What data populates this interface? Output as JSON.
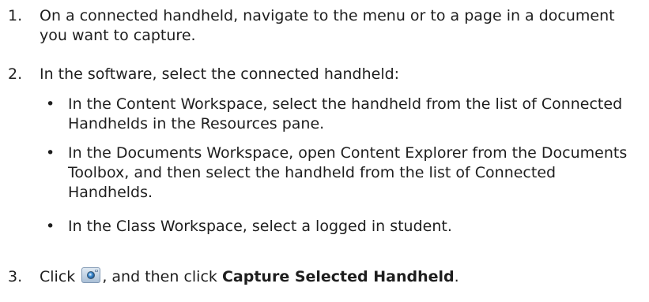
{
  "steps": [
    {
      "number": "1.",
      "text": "On a connected handheld, navigate to the menu or to a page in a document you want to capture."
    },
    {
      "number": "2.",
      "text": "In the software, select the connected handheld:",
      "bullets": [
        {
          "symbol": "•",
          "text": "In the Content Workspace, select the handheld from the list of Connected Handhelds in the Resources pane."
        },
        {
          "symbol": "•",
          "text": "In the Documents Workspace, open Content Explorer from the Documents Toolbox, and then select the handheld from the list of Connected Handhelds."
        },
        {
          "symbol": "•",
          "text": "In the Class Workspace, select a logged in student."
        }
      ]
    },
    {
      "number": "3.",
      "text_before_icon": "Click",
      "icon": "capture-screen-camera-icon",
      "text_after_icon": ", and then click",
      "bold_text": "Capture Selected Handheld",
      "text_end": "."
    }
  ]
}
